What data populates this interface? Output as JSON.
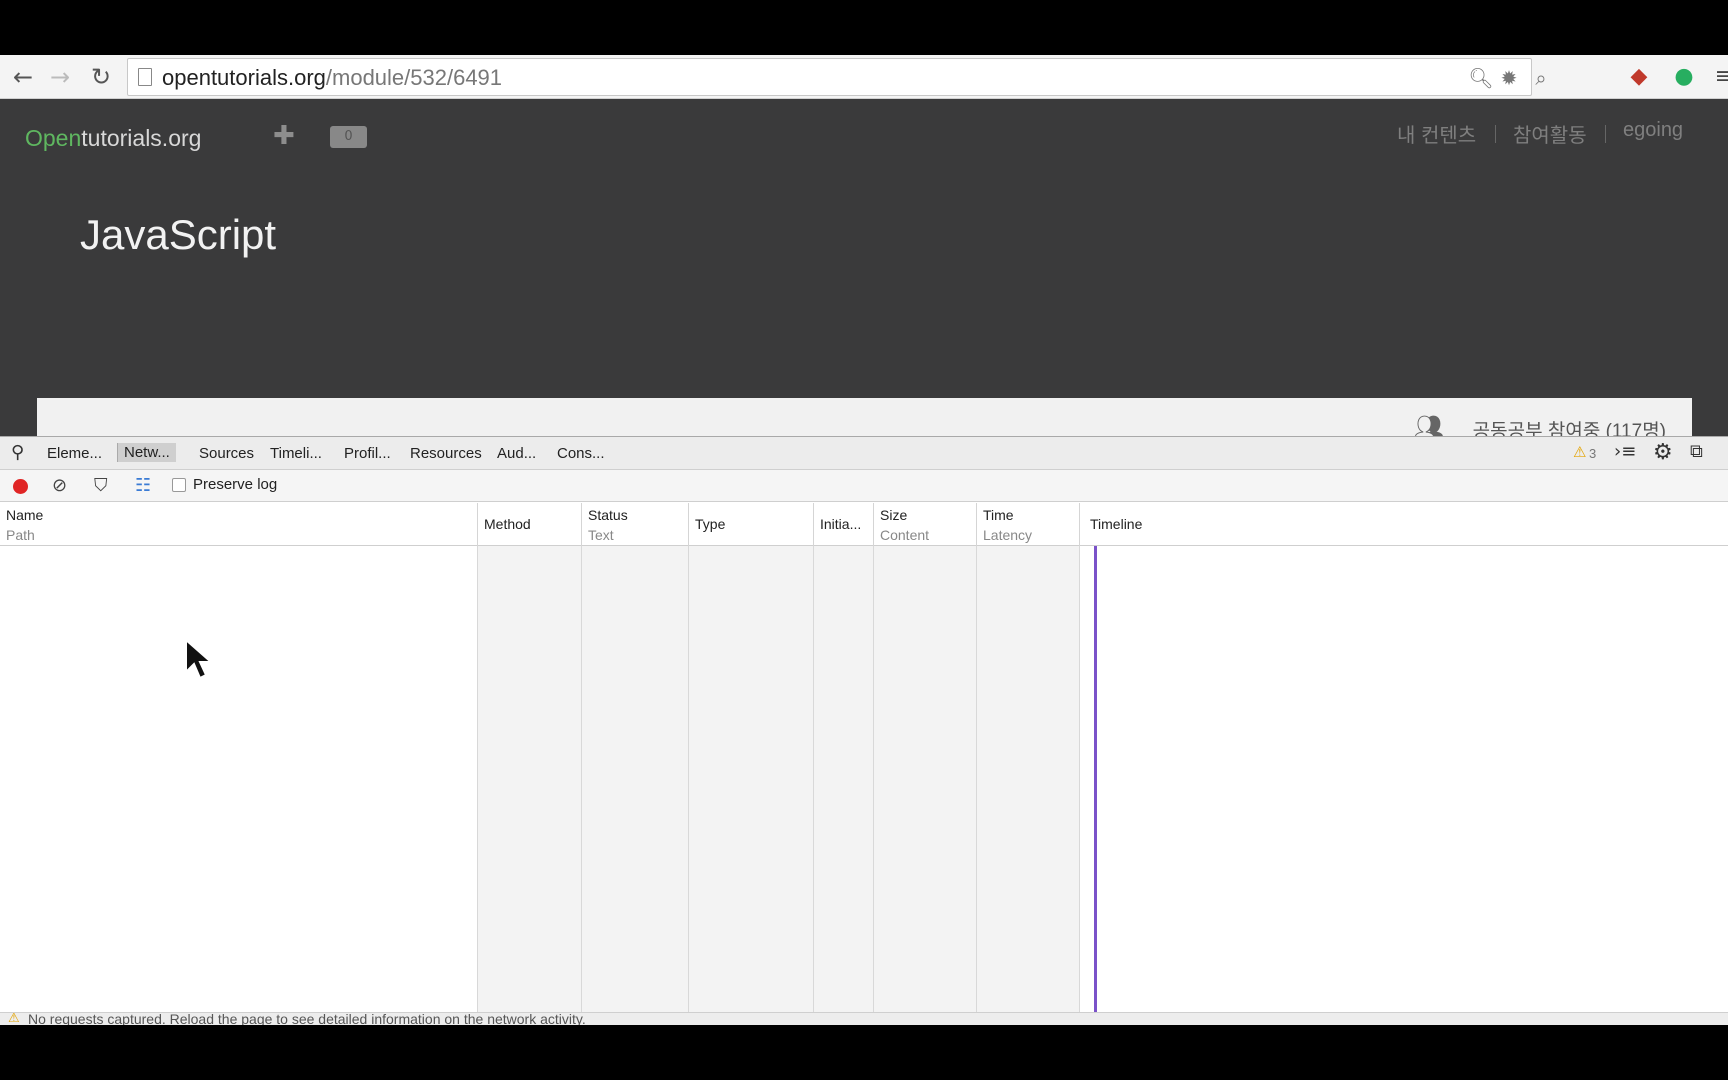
{
  "browser": {
    "url_host": "opentutorials.org",
    "url_path": "/module/532/6491"
  },
  "site": {
    "logo_open": "Open",
    "logo_rest": "tutorials.org",
    "badge_count": "0",
    "nav": [
      "내 컨텐츠",
      "참여활동",
      "egoing"
    ],
    "title": "JavaScript",
    "study_label": "공동공부 참여중 (117명)"
  },
  "devtools": {
    "tabs": [
      "Eleme...",
      "Netw...",
      "Sources",
      "Timeli...",
      "Profil...",
      "Resources",
      "Aud...",
      "Cons..."
    ],
    "active_tab": "Netw...",
    "warning_count": "3",
    "preserve_log": "Preserve log",
    "columns": {
      "name": "Name",
      "path": "Path",
      "method": "Method",
      "status": "Status",
      "text": "Text",
      "type": "Type",
      "initiator": "Initia...",
      "size": "Size",
      "content": "Content",
      "time": "Time",
      "latency": "Latency",
      "timeline": "Timeline"
    },
    "status_message": "No requests captured. Reload the page to see detailed information on the network activity."
  },
  "colors": {
    "site_bg": "#3a3a3b",
    "logo_green": "#5fb760",
    "record_red": "#e02525",
    "timeline_marker": "#7a52c9"
  }
}
